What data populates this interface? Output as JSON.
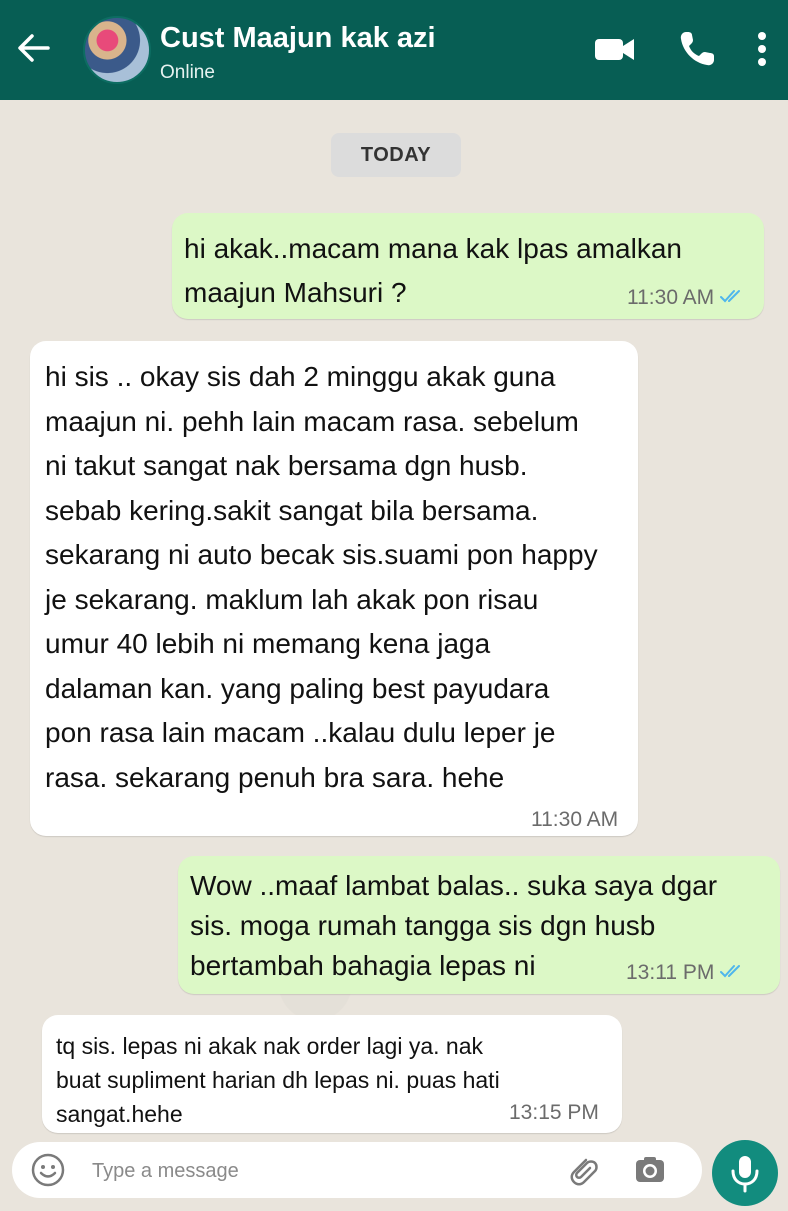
{
  "header": {
    "contact_name": "Cust Maajun kak azi",
    "status": "Online",
    "icons": [
      "back-arrow-icon",
      "avatar",
      "video-call-icon",
      "phone-icon",
      "more-vert-icon"
    ]
  },
  "chat": {
    "day_label": "TODAY",
    "messages": [
      {
        "direction": "outgoing",
        "text": "hi akak..macam mana kak lpas amalkan\nmaajun Mahsuri ?",
        "time": "11:30 AM",
        "read": true
      },
      {
        "direction": "incoming",
        "text": "hi sis .. okay sis dah 2 minggu akak guna\nmaajun ni. pehh lain macam rasa. sebelum\nni takut sangat nak bersama dgn husb.\nsebab kering.sakit sangat bila bersama.\nsekarang ni auto becak sis.suami pon happy\nje sekarang. maklum lah akak pon risau\numur 40 lebih ni memang kena jaga\ndalaman kan. yang paling best payudara\npon rasa lain macam ..kalau dulu leper je\nrasa. sekarang penuh bra sara. hehe",
        "time": "11:30 AM"
      },
      {
        "direction": "outgoing",
        "text": "Wow ..maaf lambat balas.. suka saya dgar\nsis. moga rumah tangga sis dgn husb\nbertambah bahagia lepas ni",
        "time": "13:11 PM",
        "read": true
      },
      {
        "direction": "incoming",
        "text": "tq sis. lepas ni akak nak order lagi ya. nak\nbuat supliment harian dh lepas ni. puas hati\nsangat.hehe",
        "time": "13:15 PM"
      }
    ]
  },
  "composer": {
    "placeholder": "Type a message",
    "icons": [
      "emoji-icon",
      "attach-icon",
      "camera-icon",
      "mic-icon"
    ]
  },
  "colors": {
    "header": "#075e54",
    "outgoing_bubble": "#dcf8c6",
    "incoming_bubble": "#ffffff",
    "read_ticks": "#4fb6ec",
    "mic_button": "#128c7e",
    "background": "#e9e4dc"
  }
}
